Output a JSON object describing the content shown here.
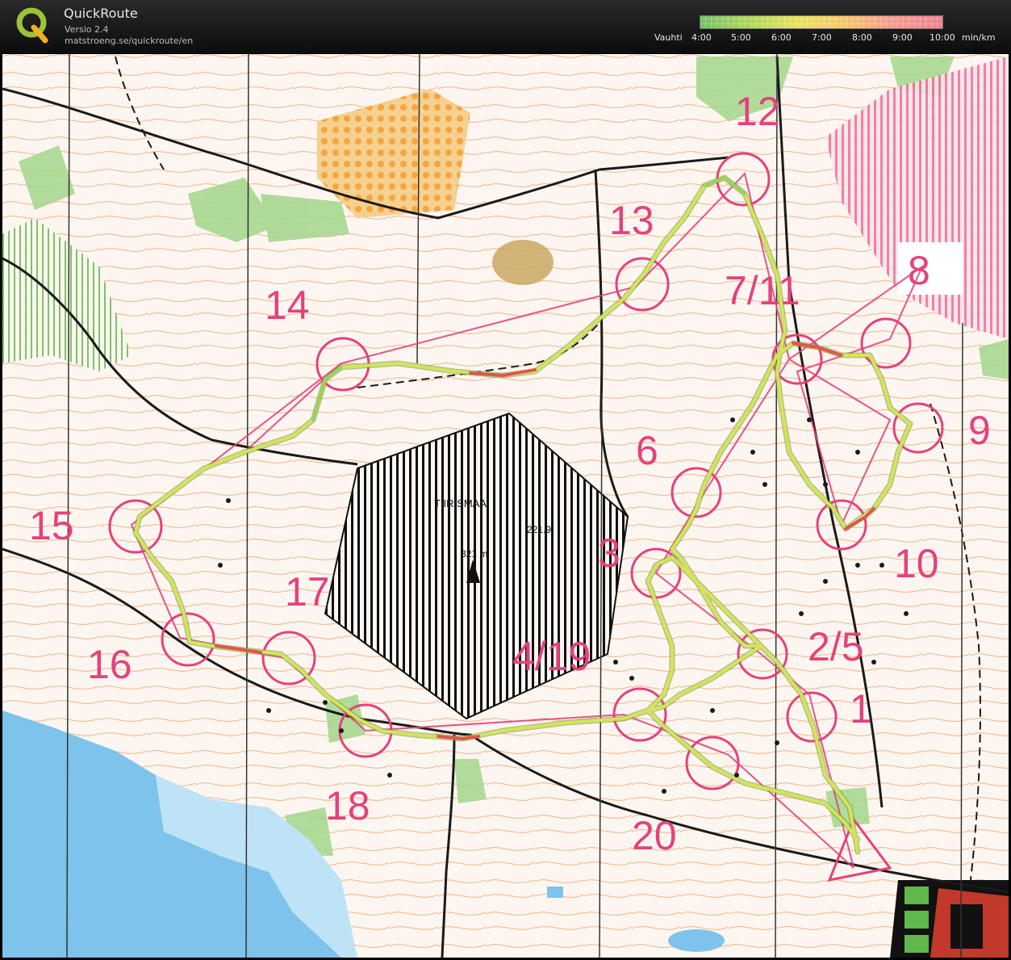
{
  "app": {
    "title": "QuickRoute",
    "version": "Versio 2.4",
    "url": "matstroeng.se/quickroute/en"
  },
  "pace_scale": {
    "label": "Vauhti",
    "ticks": [
      "4:00",
      "5:00",
      "6:00",
      "7:00",
      "8:00",
      "9:00",
      "10:00"
    ],
    "unit": "min/km",
    "colors": {
      "fast": "#72c266",
      "mid": "#e6e35a",
      "slow": "#f0838e"
    }
  },
  "map": {
    "area_name": "TIIRISMAA",
    "spot_height": "221.9",
    "tower_height": "321 m",
    "controls": [
      {
        "id": "c1",
        "label": "1"
      },
      {
        "id": "c2",
        "label": "2/5"
      },
      {
        "id": "c3",
        "label": "3"
      },
      {
        "id": "c4",
        "label": "4/19"
      },
      {
        "id": "c6",
        "label": "6"
      },
      {
        "id": "c7",
        "label": "7/11"
      },
      {
        "id": "c8",
        "label": "8"
      },
      {
        "id": "c9",
        "label": "9"
      },
      {
        "id": "c10",
        "label": "10"
      },
      {
        "id": "c12",
        "label": "12"
      },
      {
        "id": "c13",
        "label": "13"
      },
      {
        "id": "c14",
        "label": "14"
      },
      {
        "id": "c15",
        "label": "15"
      },
      {
        "id": "c16",
        "label": "16"
      },
      {
        "id": "c17",
        "label": "17"
      },
      {
        "id": "c18",
        "label": "18"
      },
      {
        "id": "c20",
        "label": "20"
      }
    ],
    "colors": {
      "course": "#e5417c",
      "contour": "#d9822e",
      "vegetation": "#8cc97a",
      "water": "#7ec3ec",
      "track": "#c9e04a",
      "paper": "#fdf6f0"
    }
  }
}
